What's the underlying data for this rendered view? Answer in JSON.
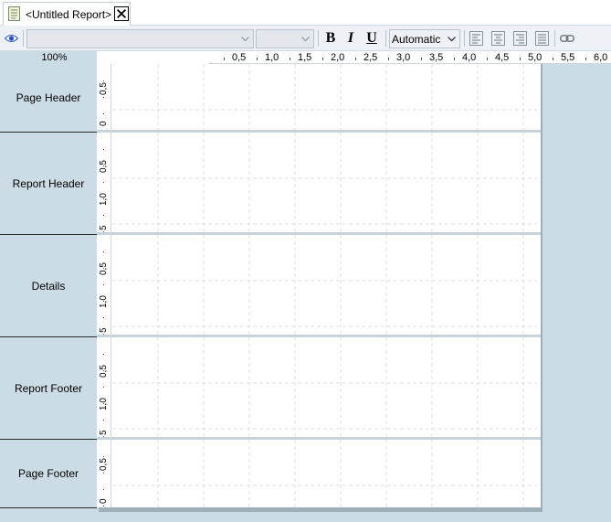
{
  "tab": {
    "title": "<Untitled Report>",
    "icon": "report-page-icon",
    "close_icon": "close-icon"
  },
  "toolbar": {
    "preview_icon": "eye-icon",
    "font_name": "",
    "font_size": "",
    "bold_label": "B",
    "italic_label": "I",
    "underline_label": "U",
    "color_value": "Automatic",
    "align_icons": [
      "align-left-icon",
      "align-center-icon",
      "align-right-icon",
      "align-justify-icon"
    ],
    "link_icon": "link-icon"
  },
  "zoom": "100%",
  "ruler": {
    "labels": [
      "0,5",
      "1,0",
      "1,5",
      "2,0",
      "2,5",
      "3,0",
      "3,5",
      "4,0",
      "4,5",
      "5,0",
      "5,5",
      "6,0"
    ]
  },
  "sections": [
    {
      "label": "Page Header",
      "ticks": [
        "0,5",
        "0"
      ]
    },
    {
      "label": "Report Header",
      "ticks": [
        "0,5",
        "1,0",
        "5"
      ]
    },
    {
      "label": "Details",
      "ticks": [
        "0,5",
        "1,0",
        "5"
      ]
    },
    {
      "label": "Report Footer",
      "ticks": [
        "0,5",
        "1,0",
        "5"
      ]
    },
    {
      "label": "Page Footer",
      "ticks": [
        "0,5",
        "0"
      ]
    }
  ],
  "colors": {
    "workspace": "#ccdce6",
    "page": "#ffffff",
    "grid": "#dde3e8"
  }
}
